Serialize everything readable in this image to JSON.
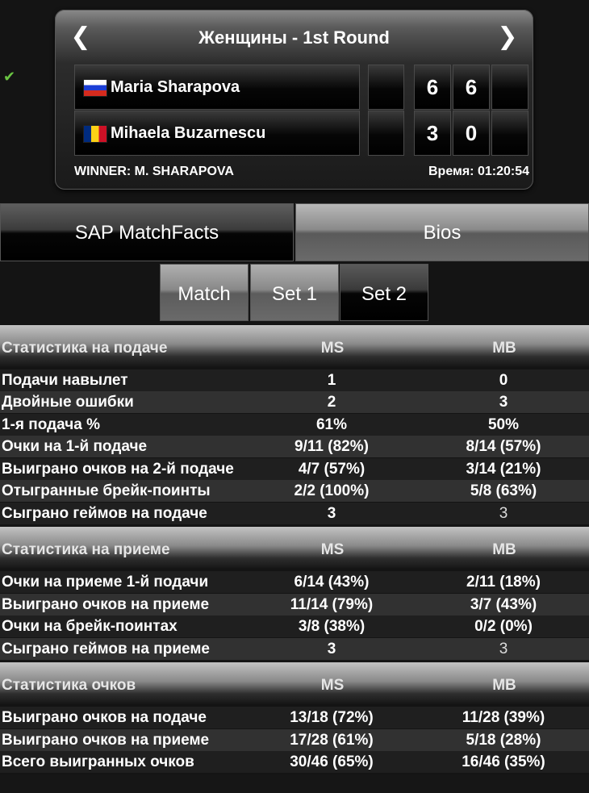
{
  "header": {
    "title": "Женщины - 1st Round",
    "prev_icon": "chevron-left-icon",
    "next_icon": "chevron-right-icon"
  },
  "players": [
    {
      "name": "Maria Sharapova",
      "flag": "russia",
      "winner": true,
      "sets": [
        "6",
        "6",
        ""
      ]
    },
    {
      "name": "Mihaela Buzarnescu",
      "flag": "romania",
      "winner": false,
      "sets": [
        "3",
        "0",
        ""
      ]
    }
  ],
  "winner_text": "WINNER: M. SHARAPOVA",
  "time_text": "Время: 01:20:54",
  "main_tabs": [
    "SAP MatchFacts",
    "Bios"
  ],
  "sub_tabs": [
    "Match",
    "Set 1",
    "Set 2"
  ],
  "sections": [
    {
      "title": "Статистика на подаче",
      "col_a": "MS",
      "col_b": "MB",
      "rows": [
        {
          "label": "Подачи навылет",
          "a": "1",
          "b": "0"
        },
        {
          "label": "Двойные ошибки",
          "a": "2",
          "b": "3"
        },
        {
          "label": "1-я подача %",
          "a": "61%",
          "b": "50%"
        },
        {
          "label": "Очки на 1-й подаче",
          "a": "9/11 (82%)",
          "b": "8/14 (57%)"
        },
        {
          "label": "Выиграно очков на 2-й подаче",
          "a": "4/7 (57%)",
          "b": "3/14 (21%)"
        },
        {
          "label": "Отыгранные брейк-поинты",
          "a": "2/2 (100%)",
          "b": "5/8 (63%)"
        },
        {
          "label": "Сыграно геймов на подаче",
          "a": "3",
          "b": "3"
        }
      ]
    },
    {
      "title": "Статистика на приеме",
      "col_a": "MS",
      "col_b": "MB",
      "rows": [
        {
          "label": "Очки на приеме 1-й подачи",
          "a": "6/14 (43%)",
          "b": "2/11 (18%)"
        },
        {
          "label": "Выиграно очков на приеме",
          "a": "11/14 (79%)",
          "b": "3/7 (43%)"
        },
        {
          "label": "Очки на брейк-поинтах",
          "a": "3/8 (38%)",
          "b": "0/2 (0%)"
        },
        {
          "label": "Сыграно геймов на приеме",
          "a": "3",
          "b": "3"
        }
      ]
    },
    {
      "title": "Статистика очков",
      "col_a": "MS",
      "col_b": "MB",
      "rows": [
        {
          "label": "Выиграно очков на подаче",
          "a": "13/18 (72%)",
          "b": "11/28 (39%)"
        },
        {
          "label": "Выиграно очков на приеме",
          "a": "17/28 (61%)",
          "b": "5/18 (28%)"
        },
        {
          "label": "Всего выигранных очков",
          "a": "30/46 (65%)",
          "b": "16/46 (35%)"
        }
      ]
    }
  ]
}
